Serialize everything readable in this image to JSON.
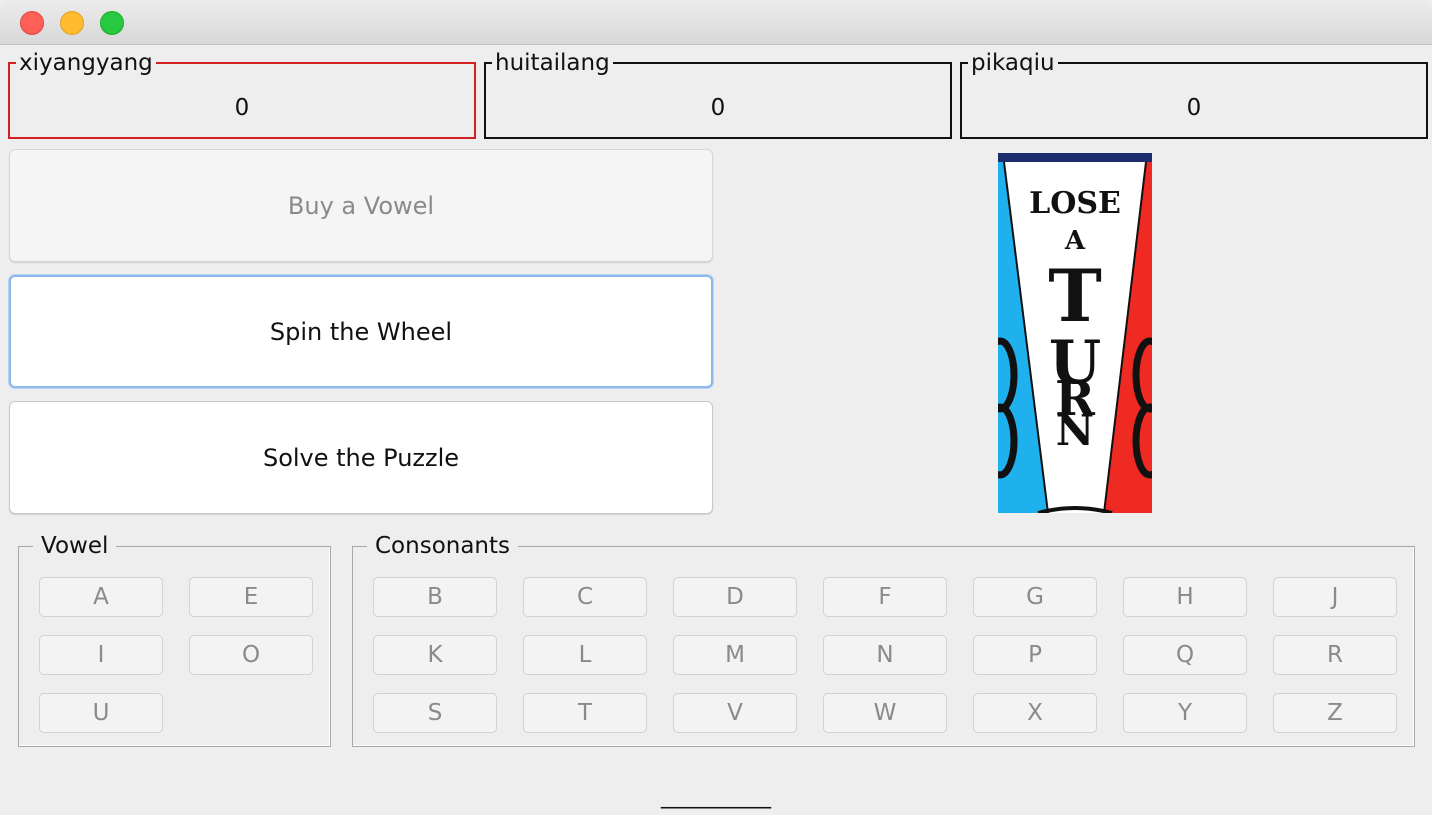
{
  "window": {
    "controls": [
      "close",
      "minimize",
      "maximize"
    ]
  },
  "players": [
    {
      "name": "xiyangyang",
      "score": "0",
      "active": true
    },
    {
      "name": "huitailang",
      "score": "0",
      "active": false
    },
    {
      "name": "pikaqiu",
      "score": "0",
      "active": false
    }
  ],
  "actions": {
    "buy_vowel": "Buy a Vowel",
    "spin_wheel": "Spin the Wheel",
    "solve_puzzle": "Solve the Puzzle"
  },
  "wheel": {
    "line1": "LOSE",
    "line2": "A",
    "line3": "TURN",
    "left_color": "#1fb0ee",
    "right_color": "#ee2a22",
    "center_color": "#ffffff"
  },
  "vowels": {
    "title": "Vowel",
    "letters": [
      "A",
      "E",
      "I",
      "O",
      "U"
    ]
  },
  "consonants": {
    "title": "Consonants",
    "letters": [
      "B",
      "C",
      "D",
      "F",
      "G",
      "H",
      "J",
      "K",
      "L",
      "M",
      "N",
      "P",
      "Q",
      "R",
      "S",
      "T",
      "V",
      "W",
      "X",
      "Y",
      "Z"
    ]
  },
  "puzzle": {
    "display": "__________"
  },
  "colors": {
    "active_border": "#d42020",
    "focus_border": "#8db8ea"
  }
}
